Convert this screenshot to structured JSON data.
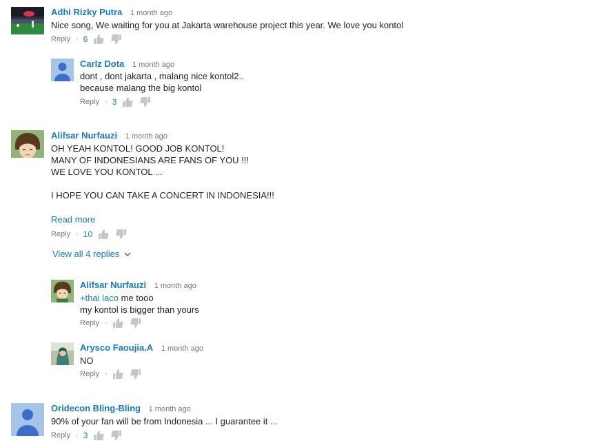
{
  "comments": [
    {
      "author": "Adhi Rizky Putra",
      "time": "1 month ago",
      "text": "Nice song, We waiting for you at Jakarta warehouse project this year. We love you kontol",
      "reply": "Reply",
      "likes": "6"
    },
    {
      "author": "Carlz Dota",
      "time": "1 month ago",
      "text": "dont , dont jakarta , malang nice kontol2..\nbecause malang the big kontol",
      "reply": "Reply",
      "likes": "3"
    },
    {
      "author": "Alifsar Nurfauzi",
      "time": "1 month ago",
      "text": "OH YEAH KONTOL! GOOD JOB KONTOL!\nMANY OF INDONESIANS ARE FANS OF YOU !!!\nWE LOVE YOU KONTOL ...\n\nI HOPE YOU CAN TAKE A CONCERT IN INDONESIA!!!",
      "read_more": "Read more",
      "reply": "Reply",
      "likes": "10",
      "view_replies": "View all 4 replies"
    },
    {
      "author": "Alifsar Nurfauzi",
      "time": "1 month ago",
      "mention": "+thai laco",
      "text_after_mention": " me tooo",
      "text": "my kontol is bigger than yours",
      "reply": "Reply"
    },
    {
      "author": "Arysco Faoujia.A",
      "time": "1 month ago",
      "text": "NO",
      "reply": "Reply"
    },
    {
      "author": "Oridecon Bling-Bling",
      "time": "1 month ago",
      "text": "90% of your fan will be from Indonesia ... I guarantee it ...",
      "reply": "Reply",
      "likes": "3"
    }
  ],
  "icons": {
    "like": "thumbs-up-icon",
    "dislike": "thumbs-down-icon",
    "expand": "chevron-down-icon"
  },
  "colors": {
    "link": "#167ac6",
    "meta": "#767676",
    "icon": "#c6c6c6"
  }
}
